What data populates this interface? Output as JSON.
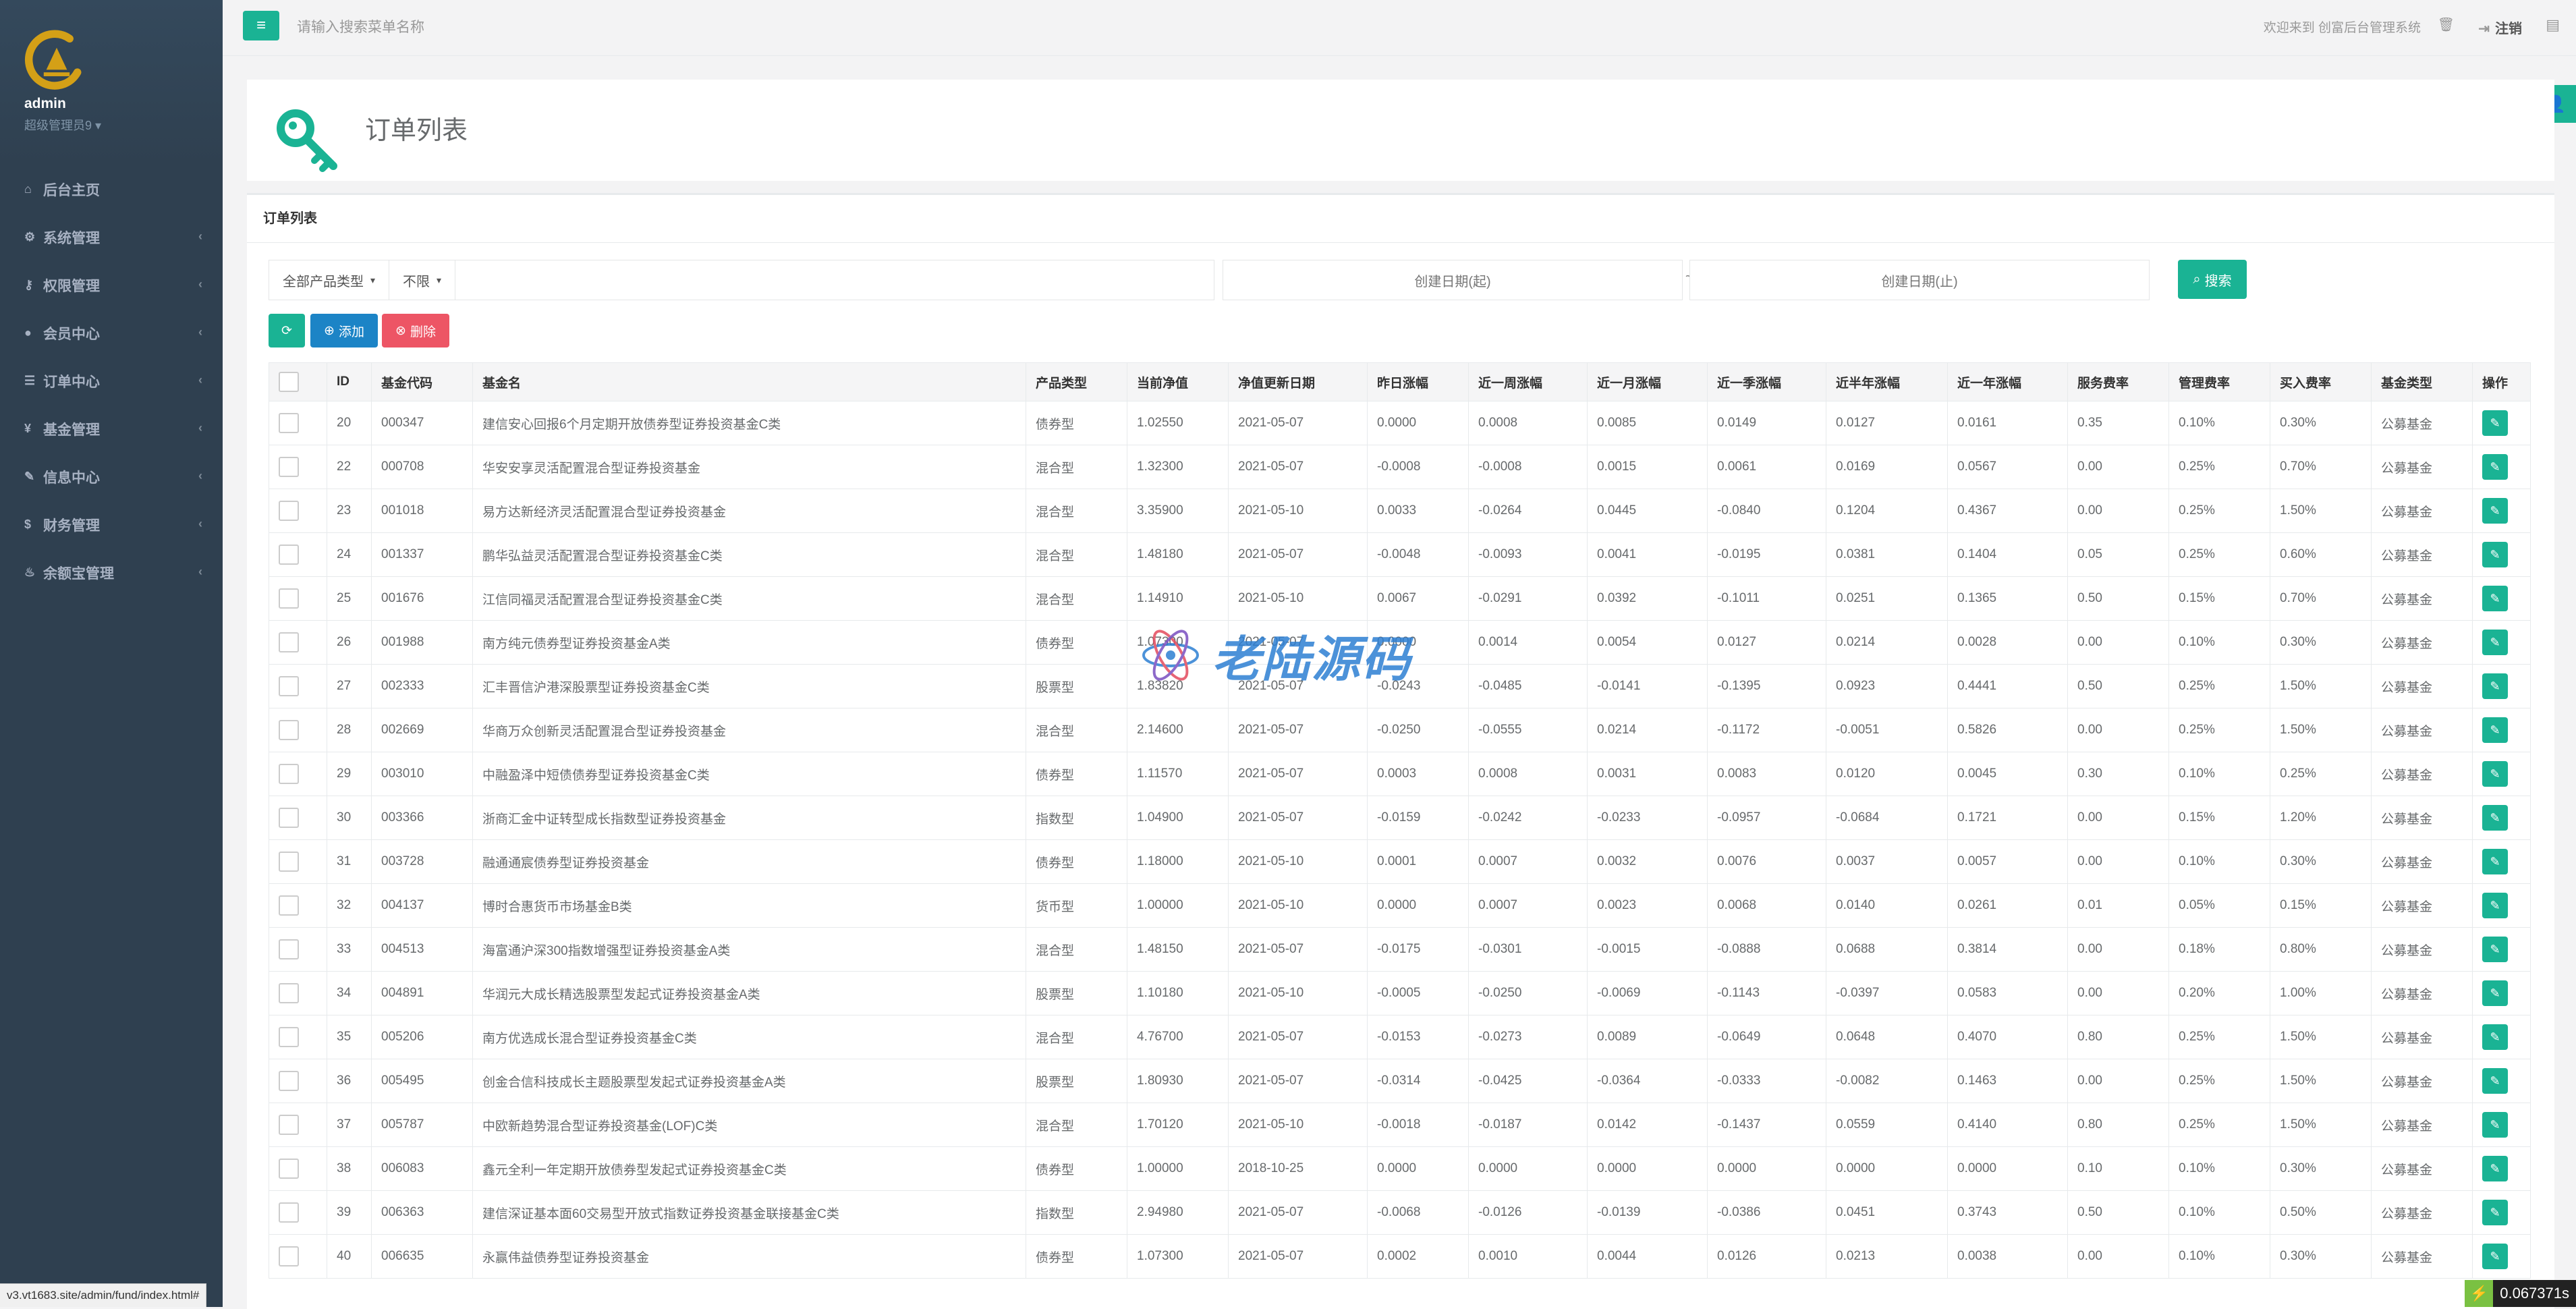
{
  "sidebar": {
    "admin_name": "admin",
    "admin_role": "超级管理员9 ▾",
    "items": [
      {
        "label": "后台主页",
        "icon": "home-icon"
      },
      {
        "label": "系统管理",
        "icon": "gears-icon"
      },
      {
        "label": "权限管理",
        "icon": "key-icon"
      },
      {
        "label": "会员中心",
        "icon": "user-icon"
      },
      {
        "label": "订单中心",
        "icon": "list-icon"
      },
      {
        "label": "基金管理",
        "icon": "yen-icon"
      },
      {
        "label": "信息中心",
        "icon": "wrench-icon"
      },
      {
        "label": "财务管理",
        "icon": "money-icon"
      },
      {
        "label": "余额宝管理",
        "icon": "fire-icon"
      }
    ]
  },
  "topbar": {
    "search_placeholder": "请输入搜索菜单名称",
    "welcome": "欢迎来到 创富后台管理系统",
    "logout": "注销"
  },
  "header": {
    "title": "订单列表"
  },
  "panel": {
    "title": "订单列表",
    "type_select": "全部产品类型",
    "period_select": "不限",
    "date_start_placeholder": "创建日期(起)",
    "date_separator": "~",
    "date_end_placeholder": "创建日期(止)",
    "search_label": "搜索",
    "add_label": "添加",
    "delete_label": "删除"
  },
  "table": {
    "columns": [
      "ID",
      "基金代码",
      "基金名",
      "产品类型",
      "当前净值",
      "净值更新日期",
      "昨日涨幅",
      "近一周涨幅",
      "近一月涨幅",
      "近一季涨幅",
      "近半年涨幅",
      "近一年涨幅",
      "服务费率",
      "管理费率",
      "买入费率",
      "基金类型",
      "操作"
    ],
    "rows": [
      [
        "20",
        "000347",
        "建信安心回报6个月定期开放债券型证券投资基金C类",
        "债券型",
        "1.02550",
        "2021-05-07",
        "0.0000",
        "0.0008",
        "0.0085",
        "0.0149",
        "0.0127",
        "0.0161",
        "0.35",
        "0.10%",
        "0.30%",
        "公募基金"
      ],
      [
        "22",
        "000708",
        "华安安享灵活配置混合型证券投资基金",
        "混合型",
        "1.32300",
        "2021-05-07",
        "-0.0008",
        "-0.0008",
        "0.0015",
        "0.0061",
        "0.0169",
        "0.0567",
        "0.00",
        "0.25%",
        "0.70%",
        "公募基金"
      ],
      [
        "23",
        "001018",
        "易方达新经济灵活配置混合型证券投资基金",
        "混合型",
        "3.35900",
        "2021-05-10",
        "0.0033",
        "-0.0264",
        "0.0445",
        "-0.0840",
        "0.1204",
        "0.4367",
        "0.00",
        "0.25%",
        "1.50%",
        "公募基金"
      ],
      [
        "24",
        "001337",
        "鹏华弘益灵活配置混合型证券投资基金C类",
        "混合型",
        "1.48180",
        "2021-05-07",
        "-0.0048",
        "-0.0093",
        "0.0041",
        "-0.0195",
        "0.0381",
        "0.1404",
        "0.05",
        "0.25%",
        "0.60%",
        "公募基金"
      ],
      [
        "25",
        "001676",
        "江信同福灵活配置混合型证券投资基金C类",
        "混合型",
        "1.14910",
        "2021-05-10",
        "0.0067",
        "-0.0291",
        "0.0392",
        "-0.1011",
        "0.0251",
        "0.1365",
        "0.50",
        "0.15%",
        "0.70%",
        "公募基金"
      ],
      [
        "26",
        "001988",
        "南方纯元债券型证券投资基金A类",
        "债券型",
        "1.07300",
        "2021-05-07",
        "0.0000",
        "0.0014",
        "0.0054",
        "0.0127",
        "0.0214",
        "0.0028",
        "0.00",
        "0.10%",
        "0.30%",
        "公募基金"
      ],
      [
        "27",
        "002333",
        "汇丰晋信沪港深股票型证券投资基金C类",
        "股票型",
        "1.83820",
        "2021-05-07",
        "-0.0243",
        "-0.0485",
        "-0.0141",
        "-0.1395",
        "0.0923",
        "0.4441",
        "0.50",
        "0.25%",
        "1.50%",
        "公募基金"
      ],
      [
        "28",
        "002669",
        "华商万众创新灵活配置混合型证券投资基金",
        "混合型",
        "2.14600",
        "2021-05-07",
        "-0.0250",
        "-0.0555",
        "0.0214",
        "-0.1172",
        "-0.0051",
        "0.5826",
        "0.00",
        "0.25%",
        "1.50%",
        "公募基金"
      ],
      [
        "29",
        "003010",
        "中融盈泽中短债债券型证券投资基金C类",
        "债券型",
        "1.11570",
        "2021-05-07",
        "0.0003",
        "0.0008",
        "0.0031",
        "0.0083",
        "0.0120",
        "0.0045",
        "0.30",
        "0.10%",
        "0.25%",
        "公募基金"
      ],
      [
        "30",
        "003366",
        "浙商汇金中证转型成长指数型证券投资基金",
        "指数型",
        "1.04900",
        "2021-05-07",
        "-0.0159",
        "-0.0242",
        "-0.0233",
        "-0.0957",
        "-0.0684",
        "0.1721",
        "0.00",
        "0.15%",
        "1.20%",
        "公募基金"
      ],
      [
        "31",
        "003728",
        "融通通宸债券型证券投资基金",
        "债券型",
        "1.18000",
        "2021-05-10",
        "0.0001",
        "0.0007",
        "0.0032",
        "0.0076",
        "0.0037",
        "0.0057",
        "0.00",
        "0.10%",
        "0.30%",
        "公募基金"
      ],
      [
        "32",
        "004137",
        "博时合惠货币市场基金B类",
        "货币型",
        "1.00000",
        "2021-05-10",
        "0.0000",
        "0.0007",
        "0.0023",
        "0.0068",
        "0.0140",
        "0.0261",
        "0.01",
        "0.05%",
        "0.15%",
        "公募基金"
      ],
      [
        "33",
        "004513",
        "海富通沪深300指数增强型证券投资基金A类",
        "混合型",
        "1.48150",
        "2021-05-07",
        "-0.0175",
        "-0.0301",
        "-0.0015",
        "-0.0888",
        "0.0688",
        "0.3814",
        "0.00",
        "0.18%",
        "0.80%",
        "公募基金"
      ],
      [
        "34",
        "004891",
        "华润元大成长精选股票型发起式证券投资基金A类",
        "股票型",
        "1.10180",
        "2021-05-10",
        "-0.0005",
        "-0.0250",
        "-0.0069",
        "-0.1143",
        "-0.0397",
        "0.0583",
        "0.00",
        "0.20%",
        "1.00%",
        "公募基金"
      ],
      [
        "35",
        "005206",
        "南方优选成长混合型证券投资基金C类",
        "混合型",
        "4.76700",
        "2021-05-07",
        "-0.0153",
        "-0.0273",
        "0.0089",
        "-0.0649",
        "0.0648",
        "0.4070",
        "0.80",
        "0.25%",
        "1.50%",
        "公募基金"
      ],
      [
        "36",
        "005495",
        "创金合信科技成长主题股票型发起式证券投资基金A类",
        "股票型",
        "1.80930",
        "2021-05-07",
        "-0.0314",
        "-0.0425",
        "-0.0364",
        "-0.0333",
        "-0.0082",
        "0.1463",
        "0.00",
        "0.25%",
        "1.50%",
        "公募基金"
      ],
      [
        "37",
        "005787",
        "中欧新趋势混合型证券投资基金(LOF)C类",
        "混合型",
        "1.70120",
        "2021-05-10",
        "-0.0018",
        "-0.0187",
        "0.0142",
        "-0.1437",
        "0.0559",
        "0.4140",
        "0.80",
        "0.25%",
        "1.50%",
        "公募基金"
      ],
      [
        "38",
        "006083",
        "鑫元全利一年定期开放债券型发起式证券投资基金C类",
        "债券型",
        "1.00000",
        "2018-10-25",
        "0.0000",
        "0.0000",
        "0.0000",
        "0.0000",
        "0.0000",
        "0.0000",
        "0.10",
        "0.10%",
        "0.30%",
        "公募基金"
      ],
      [
        "39",
        "006363",
        "建信深证基本面60交易型开放式指数证券投资基金联接基金C类",
        "指数型",
        "2.94980",
        "2021-05-07",
        "-0.0068",
        "-0.0126",
        "-0.0139",
        "-0.0386",
        "0.0451",
        "0.3743",
        "0.50",
        "0.10%",
        "0.50%",
        "公募基金"
      ],
      [
        "40",
        "006635",
        "永赢伟益债券型证券投资基金",
        "债券型",
        "1.07300",
        "2021-05-07",
        "0.0002",
        "0.0010",
        "0.0044",
        "0.0126",
        "0.0213",
        "0.0038",
        "0.00",
        "0.10%",
        "0.30%",
        "公募基金"
      ]
    ]
  },
  "status_url": "v3.vt1683.site/admin/fund/index.html#",
  "watermark": "老陆源码",
  "timer": "0.067371s"
}
